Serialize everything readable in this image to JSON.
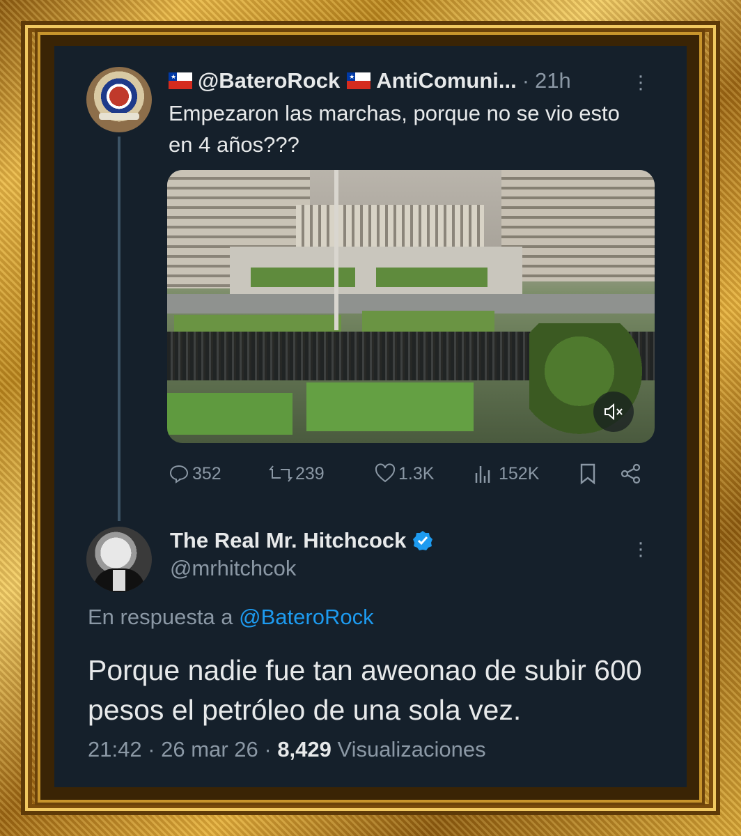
{
  "tweet": {
    "author_handle": "@BateroRock",
    "author_name": "AntiComuni...",
    "time": "21h",
    "separator": "·",
    "flag_icon": "chile-flag-icon",
    "text": "Empezaron las marchas, porque no se vio esto en 4 años???",
    "media": {
      "mute_icon": "volume-mute-icon"
    },
    "stats": {
      "replies": "352",
      "retweets": "239",
      "likes": "1.3K",
      "views": "152K"
    }
  },
  "reply": {
    "name": "The Real Mr. Hitchcock",
    "handle": "@mrhitchcok",
    "verified_color": "#1d9bf0",
    "in_reply_prefix": "En respuesta a",
    "in_reply_handle": "@BateroRock",
    "text": "Porque nadie fue tan aweonao de subir 600 pesos el petróleo de una sola vez.",
    "time": "21:42",
    "date": "26 mar 26",
    "views_count": "8,429",
    "views_label": "Visualizaciones",
    "separator": "·"
  },
  "colors": {
    "background": "#15202b",
    "text": "#e7e9ea",
    "muted": "#8b98a5",
    "accent": "#1d9bf0",
    "frame_gold": "#d4a43a"
  }
}
